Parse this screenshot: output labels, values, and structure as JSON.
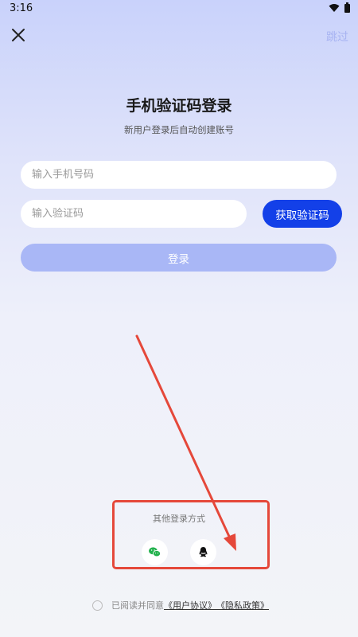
{
  "status_bar": {
    "time": "3:16",
    "wifi_icon": "wifi-icon",
    "battery_icon": "battery-icon"
  },
  "header": {
    "close_icon": "close-icon",
    "skip_label": "跳过"
  },
  "main": {
    "title": "手机验证码登录",
    "subtitle": "新用户登录后自动创建账号",
    "phone_placeholder": "输入手机号码",
    "code_placeholder": "输入验证码",
    "get_code_label": "获取验证码",
    "login_label": "登录"
  },
  "other_login": {
    "label": "其他登录方式",
    "methods": [
      {
        "name": "wechat",
        "icon": "wechat-icon",
        "color": "#22b14c"
      },
      {
        "name": "qq",
        "icon": "qq-icon",
        "color": "#000000"
      }
    ]
  },
  "agreement": {
    "prefix": "已阅读并同意",
    "user_agreement": "《用户协议》",
    "privacy_policy": "《隐私政策》"
  },
  "colors": {
    "primary": "#1340e8",
    "login_disabled": "#a9b7f6",
    "skip": "#a7b3f2",
    "annotation": "#e5483a"
  }
}
